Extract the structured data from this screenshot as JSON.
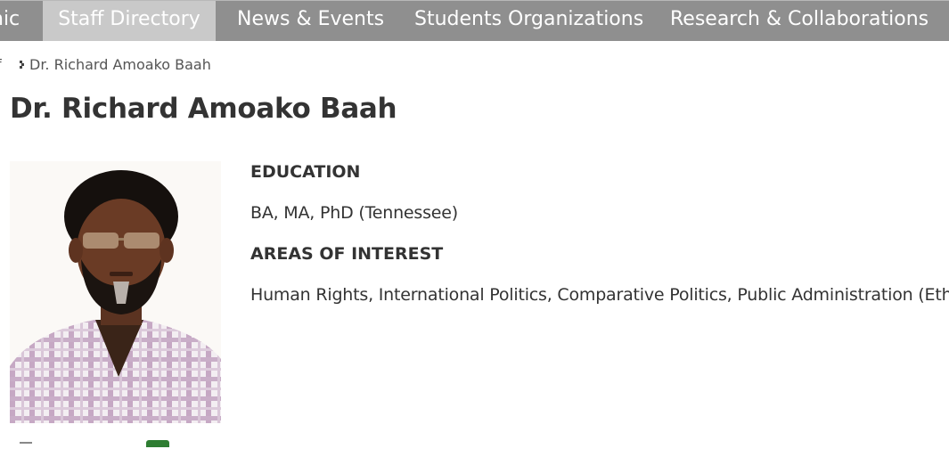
{
  "nav": {
    "items": [
      {
        "label": "nic",
        "active": false
      },
      {
        "label": "Staff Directory",
        "active": true
      },
      {
        "label": "News & Events",
        "active": false
      },
      {
        "label": "Students Organizations",
        "active": false
      },
      {
        "label": "Research & Collaborations",
        "active": false
      }
    ]
  },
  "breadcrumb": {
    "previous": "f",
    "separator_icon": "chevron-right-icon",
    "current": "Dr. Richard Amoako Baah"
  },
  "profile": {
    "name": "Dr. Richard Amoako Baah",
    "photo_icon": "staff-photo",
    "education_heading": "EDUCATION",
    "education": "BA, MA, PhD (Tennessee)",
    "interests_heading": "AREAS OF INTEREST",
    "interests": "Human Rights, International Politics, Comparative Politics, Public Administration (Ethics)"
  },
  "colors": {
    "navbar": "#8f8f8f",
    "nav_active": "#c9c9c9",
    "text": "#333333",
    "accent_green": "#2e7d32"
  }
}
